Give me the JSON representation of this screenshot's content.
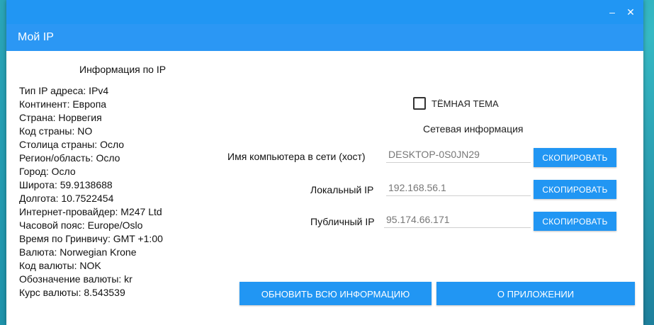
{
  "window": {
    "minimize_label": "‒",
    "close_label": "✕"
  },
  "app": {
    "title": "Мой IP"
  },
  "info": {
    "title": "Информация по IP",
    "lines": [
      "Тип IP адреса: IPv4",
      "Континент: Европа",
      "Страна: Норвегия",
      "Код страны: NO",
      "Столица страны: Осло",
      "Регион/область: Осло",
      "Город: Осло",
      "Широта: 59.9138688",
      "Долгота: 10.7522454",
      "Интернет-провайдер: M247 Ltd",
      "Часовой пояс: Europe/Oslo",
      "Время по Гринвичу: GMT +1:00",
      "Валюта: Norwegian Krone",
      "Код валюты: NOK",
      "Обозначение валюты: kr",
      "Курс валюты: 8.543539"
    ]
  },
  "theme": {
    "label": "ТЁМНАЯ ТЕМА",
    "checked": false
  },
  "network": {
    "title": "Сетевая информация",
    "hostname_label": "Имя компьютера в сети (хост)",
    "hostname_value": "DESKTOP-0S0JN29",
    "local_ip_label": "Локальный IP",
    "local_ip_value": "192.168.56.1",
    "public_ip_label": "Публичный IP",
    "public_ip_value": "95.174.66.171",
    "copy_label": "СКОПИРОВАТЬ"
  },
  "footer": {
    "refresh_label": "ОБНОВИТЬ ВСЮ ИНФОРМАЦИЮ",
    "about_label": "О ПРИЛОЖЕНИИ"
  },
  "colors": {
    "accent": "#2196f3",
    "background": "#ffffff"
  }
}
